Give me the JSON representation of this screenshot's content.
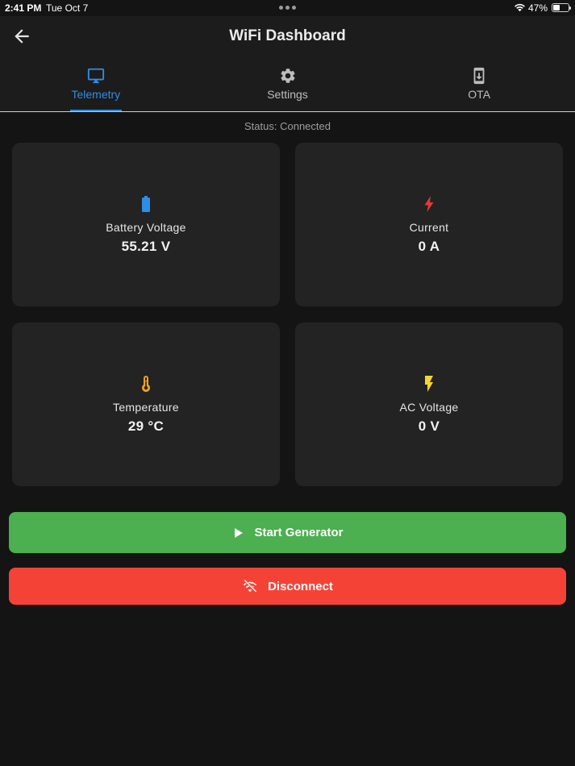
{
  "status_bar": {
    "time": "2:41 PM",
    "date": "Tue Oct 7",
    "battery_percent": "47%",
    "battery_level": 0.47
  },
  "header": {
    "title": "WiFi Dashboard",
    "back_icon": "arrow-left-icon"
  },
  "tabs": [
    {
      "label": "Telemetry",
      "icon": "monitor-icon",
      "active": true
    },
    {
      "label": "Settings",
      "icon": "gear-icon",
      "active": false
    },
    {
      "label": "OTA",
      "icon": "phone-download-icon",
      "active": false
    }
  ],
  "status": "Status: Connected",
  "cards": [
    {
      "label": "Battery Voltage",
      "value": "55.21 V",
      "icon": "battery-icon",
      "icon_color": "#2e8ee6"
    },
    {
      "label": "Current",
      "value": "0 A",
      "icon": "flash-icon",
      "icon_color": "#e53935"
    },
    {
      "label": "Temperature",
      "value": "29 °C",
      "icon": "thermometer-icon",
      "icon_color": "#f0a020"
    },
    {
      "label": "AC Voltage",
      "value": "0 V",
      "icon": "bolt-icon",
      "icon_color": "#f4d535"
    }
  ],
  "buttons": {
    "start_label": "Start Generator",
    "start_color": "#4caf50",
    "disconnect_label": "Disconnect",
    "disconnect_color": "#f44336"
  },
  "colors": {
    "accent": "#2e8ee6",
    "background": "#141414",
    "surface": "#232323"
  }
}
